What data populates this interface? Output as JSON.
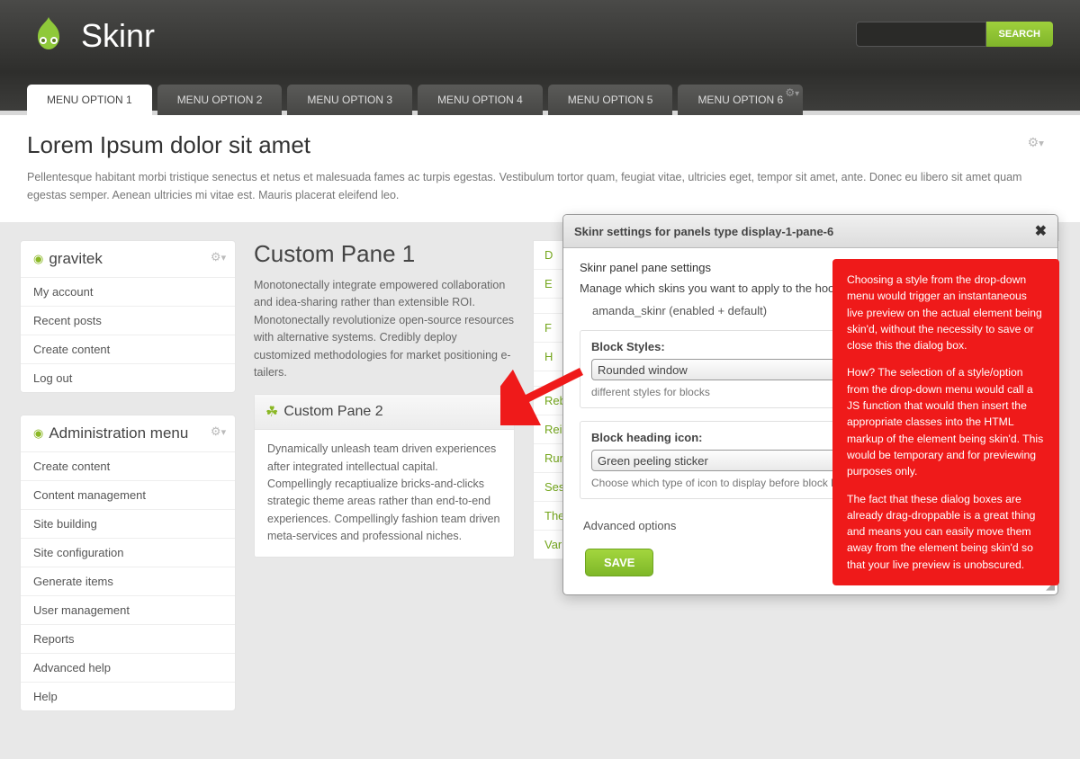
{
  "site": {
    "title": "Skinr",
    "search_btn": "SEARCH",
    "search_placeholder": ""
  },
  "tabs": [
    {
      "label": "MENU OPTION 1",
      "active": true
    },
    {
      "label": "MENU OPTION 2"
    },
    {
      "label": "MENU OPTION 3"
    },
    {
      "label": "MENU OPTION 4"
    },
    {
      "label": "MENU OPTION 5"
    },
    {
      "label": "MENU OPTION 6",
      "gear": true
    }
  ],
  "page": {
    "title": "Lorem Ipsum dolor sit amet",
    "desc": "Pellentesque habitant morbi tristique senectus et netus et malesuada fames ac turpis egestas. Vestibulum tortor quam, feugiat vitae, ultricies eget, tempor sit amet, ante. Donec eu libero sit amet quam egestas semper. Aenean ultricies mi vitae est. Mauris placerat eleifend leo."
  },
  "sidebar": {
    "user_block": {
      "title": "gravitek",
      "items": [
        "My account",
        "Recent posts",
        "Create content",
        "Log out"
      ]
    },
    "admin_block": {
      "title": "Administration menu",
      "items": [
        "Create content",
        "Content management",
        "Site building",
        "Site configuration",
        "Generate items",
        "User management",
        "Reports",
        "Advanced help",
        "Help"
      ]
    }
  },
  "mid": {
    "pane1_title": "Custom Pane 1",
    "pane1_body": "Monotonectally integrate empowered collaboration and idea-sharing rather than extensible ROI. Monotonectally revolutionize open-source resources with alternative systems. Credibly deploy customized methodologies for market positioning e-tailers.",
    "pane2_title": "Custom Pane 2",
    "pane2_body": "Dynamically unleash team driven experiences after integrated intellectual capital. Compellingly recaptiualize bricks-and-clicks strategic theme areas rather than end-to-end experiences. Compellingly fashion team driven meta-services and professional niches."
  },
  "dev_menu": [
    "D",
    "E",
    "",
    "F",
    "H",
    "",
    "Rebuild menus",
    "Reinstall modules",
    "Run cron",
    "Session viewer",
    "Theme registry",
    "Variable editor"
  ],
  "dialog": {
    "title": "Skinr settings for panels type display-1-pane-6",
    "sub": "Skinr panel pane settings",
    "desc": "Manage which skins you want to apply to the hooks",
    "theme": "amanda_skinr (enabled + default)",
    "f1_label": "Block Styles:",
    "f1_value": "Rounded window",
    "f1_help": "different styles for blocks",
    "f2_label": "Block heading icon:",
    "f2_value": "Green peeling sticker",
    "f2_help": "Choose which type of icon to display before block heading",
    "adv": "Advanced options",
    "save": "SAVE"
  },
  "annot": {
    "p1": "Choosing a style from the drop-down menu would trigger an instantaneous live preview on the actual element being skin'd, without the necessity to save or close this the dialog box.",
    "p2": "How? The selection of a style/option from the drop-down menu would call a JS function that would then insert the appropriate classes into the HTML markup of the element being skin'd. This would be temporary and for previewing purposes only.",
    "p3": "The fact that these dialog boxes are already drag-droppable is a great thing and means you can easily move them away from the element being skin'd so that your live preview is unobscured."
  }
}
